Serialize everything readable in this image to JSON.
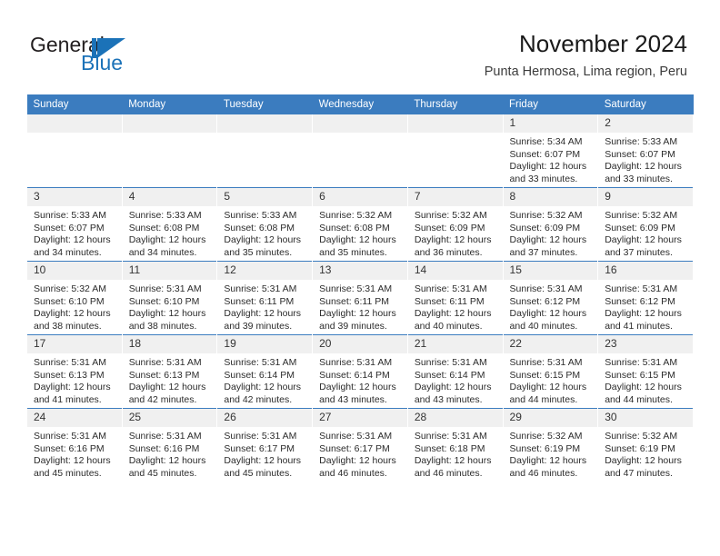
{
  "brand": {
    "name_part1": "General",
    "name_part2": "Blue",
    "mark": "triangle-play-icon",
    "accent_color": "#1b72b8"
  },
  "header": {
    "title": "November 2024",
    "subtitle": "Punta Hermosa, Lima region, Peru"
  },
  "calendar": {
    "header_color": "#3b7cbf",
    "daynum_band_color": "#f0f0f0",
    "weekday_headers": [
      "Sunday",
      "Monday",
      "Tuesday",
      "Wednesday",
      "Thursday",
      "Friday",
      "Saturday"
    ],
    "labels": {
      "sunrise": "Sunrise:",
      "sunset": "Sunset:",
      "daylight": "Daylight:"
    },
    "weeks": [
      [
        {
          "day": "",
          "empty": true
        },
        {
          "day": "",
          "empty": true
        },
        {
          "day": "",
          "empty": true
        },
        {
          "day": "",
          "empty": true
        },
        {
          "day": "",
          "empty": true
        },
        {
          "day": "1",
          "sunrise": "Sunrise: 5:34 AM",
          "sunset": "Sunset: 6:07 PM",
          "daylight": "Daylight: 12 hours and 33 minutes."
        },
        {
          "day": "2",
          "sunrise": "Sunrise: 5:33 AM",
          "sunset": "Sunset: 6:07 PM",
          "daylight": "Daylight: 12 hours and 33 minutes."
        }
      ],
      [
        {
          "day": "3",
          "sunrise": "Sunrise: 5:33 AM",
          "sunset": "Sunset: 6:07 PM",
          "daylight": "Daylight: 12 hours and 34 minutes."
        },
        {
          "day": "4",
          "sunrise": "Sunrise: 5:33 AM",
          "sunset": "Sunset: 6:08 PM",
          "daylight": "Daylight: 12 hours and 34 minutes."
        },
        {
          "day": "5",
          "sunrise": "Sunrise: 5:33 AM",
          "sunset": "Sunset: 6:08 PM",
          "daylight": "Daylight: 12 hours and 35 minutes."
        },
        {
          "day": "6",
          "sunrise": "Sunrise: 5:32 AM",
          "sunset": "Sunset: 6:08 PM",
          "daylight": "Daylight: 12 hours and 35 minutes."
        },
        {
          "day": "7",
          "sunrise": "Sunrise: 5:32 AM",
          "sunset": "Sunset: 6:09 PM",
          "daylight": "Daylight: 12 hours and 36 minutes."
        },
        {
          "day": "8",
          "sunrise": "Sunrise: 5:32 AM",
          "sunset": "Sunset: 6:09 PM",
          "daylight": "Daylight: 12 hours and 37 minutes."
        },
        {
          "day": "9",
          "sunrise": "Sunrise: 5:32 AM",
          "sunset": "Sunset: 6:09 PM",
          "daylight": "Daylight: 12 hours and 37 minutes."
        }
      ],
      [
        {
          "day": "10",
          "sunrise": "Sunrise: 5:32 AM",
          "sunset": "Sunset: 6:10 PM",
          "daylight": "Daylight: 12 hours and 38 minutes."
        },
        {
          "day": "11",
          "sunrise": "Sunrise: 5:31 AM",
          "sunset": "Sunset: 6:10 PM",
          "daylight": "Daylight: 12 hours and 38 minutes."
        },
        {
          "day": "12",
          "sunrise": "Sunrise: 5:31 AM",
          "sunset": "Sunset: 6:11 PM",
          "daylight": "Daylight: 12 hours and 39 minutes."
        },
        {
          "day": "13",
          "sunrise": "Sunrise: 5:31 AM",
          "sunset": "Sunset: 6:11 PM",
          "daylight": "Daylight: 12 hours and 39 minutes."
        },
        {
          "day": "14",
          "sunrise": "Sunrise: 5:31 AM",
          "sunset": "Sunset: 6:11 PM",
          "daylight": "Daylight: 12 hours and 40 minutes."
        },
        {
          "day": "15",
          "sunrise": "Sunrise: 5:31 AM",
          "sunset": "Sunset: 6:12 PM",
          "daylight": "Daylight: 12 hours and 40 minutes."
        },
        {
          "day": "16",
          "sunrise": "Sunrise: 5:31 AM",
          "sunset": "Sunset: 6:12 PM",
          "daylight": "Daylight: 12 hours and 41 minutes."
        }
      ],
      [
        {
          "day": "17",
          "sunrise": "Sunrise: 5:31 AM",
          "sunset": "Sunset: 6:13 PM",
          "daylight": "Daylight: 12 hours and 41 minutes."
        },
        {
          "day": "18",
          "sunrise": "Sunrise: 5:31 AM",
          "sunset": "Sunset: 6:13 PM",
          "daylight": "Daylight: 12 hours and 42 minutes."
        },
        {
          "day": "19",
          "sunrise": "Sunrise: 5:31 AM",
          "sunset": "Sunset: 6:14 PM",
          "daylight": "Daylight: 12 hours and 42 minutes."
        },
        {
          "day": "20",
          "sunrise": "Sunrise: 5:31 AM",
          "sunset": "Sunset: 6:14 PM",
          "daylight": "Daylight: 12 hours and 43 minutes."
        },
        {
          "day": "21",
          "sunrise": "Sunrise: 5:31 AM",
          "sunset": "Sunset: 6:14 PM",
          "daylight": "Daylight: 12 hours and 43 minutes."
        },
        {
          "day": "22",
          "sunrise": "Sunrise: 5:31 AM",
          "sunset": "Sunset: 6:15 PM",
          "daylight": "Daylight: 12 hours and 44 minutes."
        },
        {
          "day": "23",
          "sunrise": "Sunrise: 5:31 AM",
          "sunset": "Sunset: 6:15 PM",
          "daylight": "Daylight: 12 hours and 44 minutes."
        }
      ],
      [
        {
          "day": "24",
          "sunrise": "Sunrise: 5:31 AM",
          "sunset": "Sunset: 6:16 PM",
          "daylight": "Daylight: 12 hours and 45 minutes."
        },
        {
          "day": "25",
          "sunrise": "Sunrise: 5:31 AM",
          "sunset": "Sunset: 6:16 PM",
          "daylight": "Daylight: 12 hours and 45 minutes."
        },
        {
          "day": "26",
          "sunrise": "Sunrise: 5:31 AM",
          "sunset": "Sunset: 6:17 PM",
          "daylight": "Daylight: 12 hours and 45 minutes."
        },
        {
          "day": "27",
          "sunrise": "Sunrise: 5:31 AM",
          "sunset": "Sunset: 6:17 PM",
          "daylight": "Daylight: 12 hours and 46 minutes."
        },
        {
          "day": "28",
          "sunrise": "Sunrise: 5:31 AM",
          "sunset": "Sunset: 6:18 PM",
          "daylight": "Daylight: 12 hours and 46 minutes."
        },
        {
          "day": "29",
          "sunrise": "Sunrise: 5:32 AM",
          "sunset": "Sunset: 6:19 PM",
          "daylight": "Daylight: 12 hours and 46 minutes."
        },
        {
          "day": "30",
          "sunrise": "Sunrise: 5:32 AM",
          "sunset": "Sunset: 6:19 PM",
          "daylight": "Daylight: 12 hours and 47 minutes."
        }
      ]
    ]
  }
}
